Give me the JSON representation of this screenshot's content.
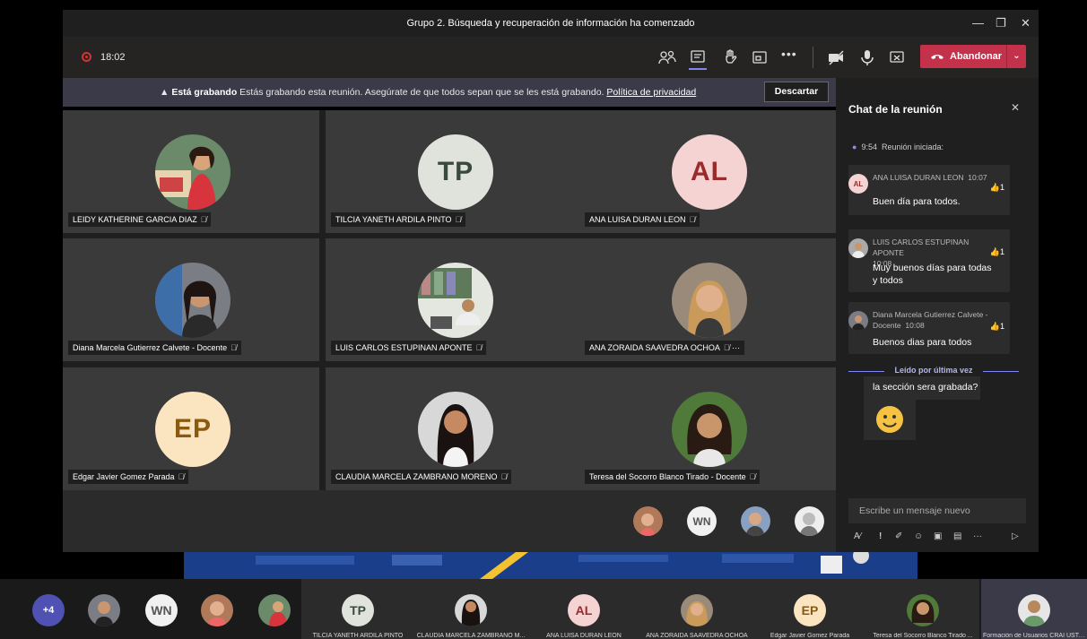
{
  "window": {
    "title": "Grupo 2. Búsqueda y recuperación de información ha comenzado",
    "minimize_icon": "minimize-icon",
    "maximize_icon": "maximize-icon",
    "close_icon": "close-icon"
  },
  "toolbar": {
    "timer": "18:02",
    "leave_label": "Abandonar"
  },
  "recording_banner": {
    "bold": "Está grabando",
    "message": " Estás grabando esta reunión. Asegúrate de que todos sepan que se les está grabando. ",
    "link": "Política de privacidad",
    "dismiss": "Descartar"
  },
  "participants": [
    {
      "name": "LEIDY KATHERINE GARCIA DIAZ",
      "initials": "",
      "photo": "photo-woman-red-dress"
    },
    {
      "name": "TILCIA YANETH ARDILA PINTO",
      "initials": "TP",
      "avatar_bg": "#dfe3dc",
      "avatar_fg": "#3a4a3a"
    },
    {
      "name": "ANA LUISA DURAN LEON",
      "initials": "AL",
      "avatar_bg": "#f6d3d3",
      "avatar_fg": "#9b2a2a"
    },
    {
      "name": "Diana Marcela Gutierrez Calvete - Docente",
      "initials": "",
      "photo": "photo-woman-dark-hair"
    },
    {
      "name": "LUIS CARLOS ESTUPINAN APONTE",
      "initials": "",
      "photo": "photo-man-office"
    },
    {
      "name": "ANA ZORAIDA SAAVEDRA OCHOA",
      "initials": "",
      "photo": "photo-woman-blonde",
      "more": "···"
    },
    {
      "name": "Edgar Javier Gomez Parada",
      "initials": "EP",
      "avatar_bg": "#fbe4c0",
      "avatar_fg": "#8a5a10"
    },
    {
      "name": "CLAUDIA MARCELA ZAMBRANO MORENO",
      "initials": "",
      "photo": "photo-woman-long-hair"
    },
    {
      "name": "Teresa del Socorro Blanco Tirado - Docente",
      "initials": "",
      "photo": "photo-woman-curly"
    }
  ],
  "overflow_thumbs": {
    "wn_initials": "WN"
  },
  "chat": {
    "title": "Chat de la reunión",
    "system_time": "9:54",
    "system_text": "Reunión iniciada:",
    "messages": [
      {
        "author": "ANA LUISA DURAN LEON",
        "time": "10:07",
        "text": "Buen día para todos.",
        "reactions": "1",
        "initials": "AL"
      },
      {
        "author": "LUIS CARLOS ESTUPINAN APONTE",
        "time": "10:08",
        "text": "Muy buenos días para todas y todos",
        "reactions": "1"
      },
      {
        "author": "Diana Marcela Gutierrez Calvete - Docente",
        "time": "10:08",
        "text": "Buenos dias para todos",
        "reactions": "1"
      }
    ],
    "last_read": "Leído por última vez",
    "my_message": "la sección sera grabada?",
    "compose_placeholder": "Escribe un mensaje nuevo",
    "tools_more": "···"
  },
  "strip": {
    "overflow_count": "+4",
    "wn": "WN",
    "tiles": [
      {
        "name": "TILCIA YANETH ARDILA PINTO",
        "initials": "TP",
        "bg": "#dfe3dc",
        "fg": "#3a4a3a"
      },
      {
        "name": "CLAUDIA MARCELA ZAMBRANO M...",
        "initials": ""
      },
      {
        "name": "ANA LUISA DURAN LEON",
        "initials": "AL",
        "bg": "#f6d3d3",
        "fg": "#9b2a2a"
      },
      {
        "name": "ANA ZORAIDA SAAVEDRA OCHOA",
        "initials": ""
      },
      {
        "name": "Edgar Javier Gomez Parada",
        "initials": "EP",
        "bg": "#fbe4c0",
        "fg": "#8a5a10"
      },
      {
        "name": "Teresa del Socorro Blanco Tirado ...",
        "initials": ""
      },
      {
        "name": "Formación de Usuarios CRAI USTA...",
        "initials": ""
      }
    ]
  },
  "colors": {
    "leave": "#c4314b",
    "accent": "#7f85f5",
    "tile": "#3a3a3a"
  }
}
